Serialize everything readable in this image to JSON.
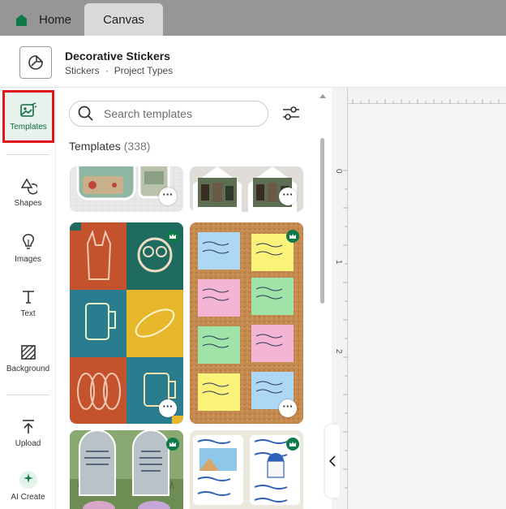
{
  "tabs": [
    {
      "label": "Home",
      "icon": "house-icon"
    },
    {
      "label": "Canvas"
    }
  ],
  "project": {
    "title": "Decorative Stickers",
    "crumb_1": "Stickers",
    "crumb_separator": "·",
    "crumb_2": "Project Types"
  },
  "rail": {
    "items": [
      {
        "label": "Templates",
        "icon": "templates-icon",
        "active": true
      },
      {
        "label": "Shapes",
        "icon": "shapes-icon"
      },
      {
        "label": "Images",
        "icon": "lightbulb-icon"
      },
      {
        "label": "Text",
        "icon": "text-icon"
      },
      {
        "label": "Background",
        "icon": "background-icon"
      },
      {
        "label": "Upload",
        "icon": "upload-icon"
      },
      {
        "label": "AI Create",
        "icon": "sparkle-icon"
      }
    ]
  },
  "panel": {
    "search_placeholder": "Search templates",
    "heading": "Templates",
    "count": "(338)",
    "more_glyph": "···"
  },
  "ruler": {
    "marks": [
      "0",
      "1",
      "2"
    ]
  },
  "colors": {
    "accent_green": "#0e7a4a",
    "active_outline": "#e0161b",
    "topbar": "#969696"
  }
}
